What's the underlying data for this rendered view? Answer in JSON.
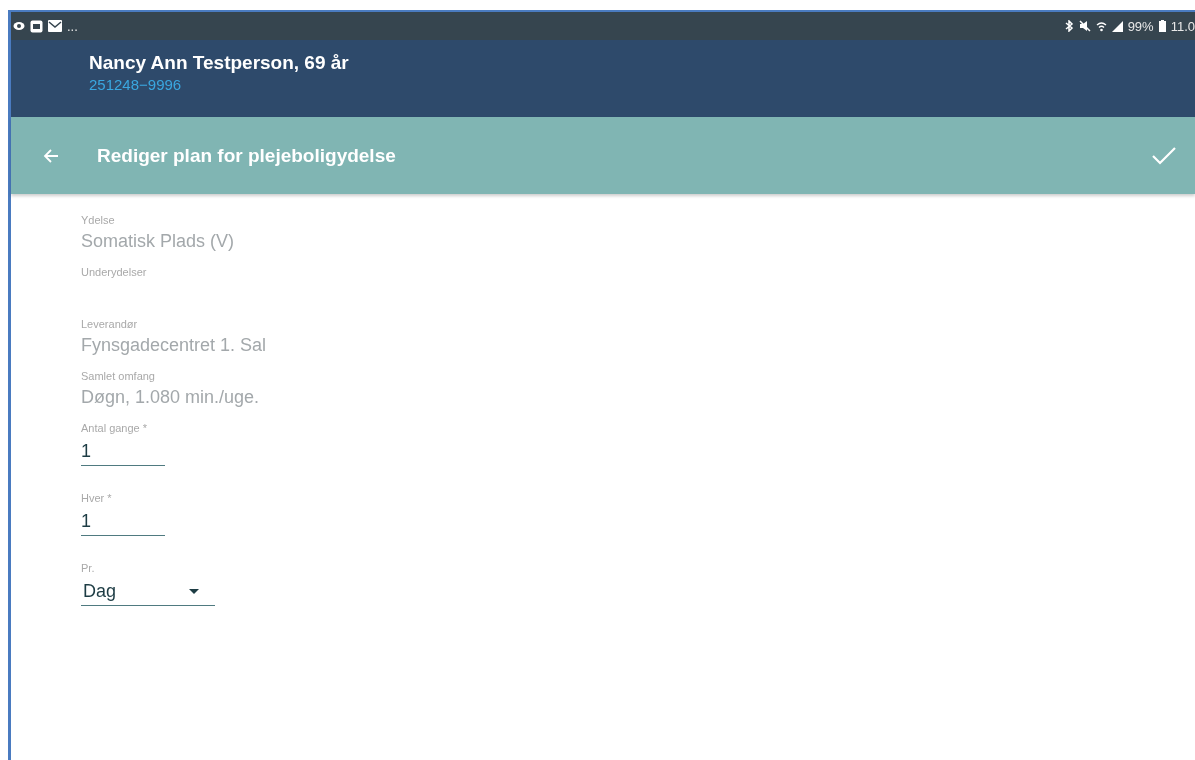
{
  "status_bar": {
    "left_text": "...",
    "battery": "99%",
    "time": "11.0"
  },
  "patient": {
    "name": "Nancy Ann Testperson, 69 år",
    "cpr": "251248−9996"
  },
  "toolbar": {
    "title": "Rediger plan for plejeboligydelse"
  },
  "fields": [
    {
      "kind": "readonly",
      "label": "Ydelse",
      "value": "Somatisk Plads (V)"
    },
    {
      "kind": "readonly",
      "label": "Underydelser"
    },
    {
      "kind": "readonly",
      "label": "Leverandør",
      "value": "Fynsgadecentret 1. Sal"
    },
    {
      "kind": "readonly",
      "label": "Samlet omfang",
      "value": "Døgn, 1.080 min./uge."
    },
    {
      "kind": "input",
      "label": "Antal gange *",
      "value": "1"
    },
    {
      "kind": "input",
      "label": "Hver *",
      "value": "1"
    },
    {
      "kind": "select",
      "label": "Pr.",
      "value": "Dag"
    }
  ]
}
